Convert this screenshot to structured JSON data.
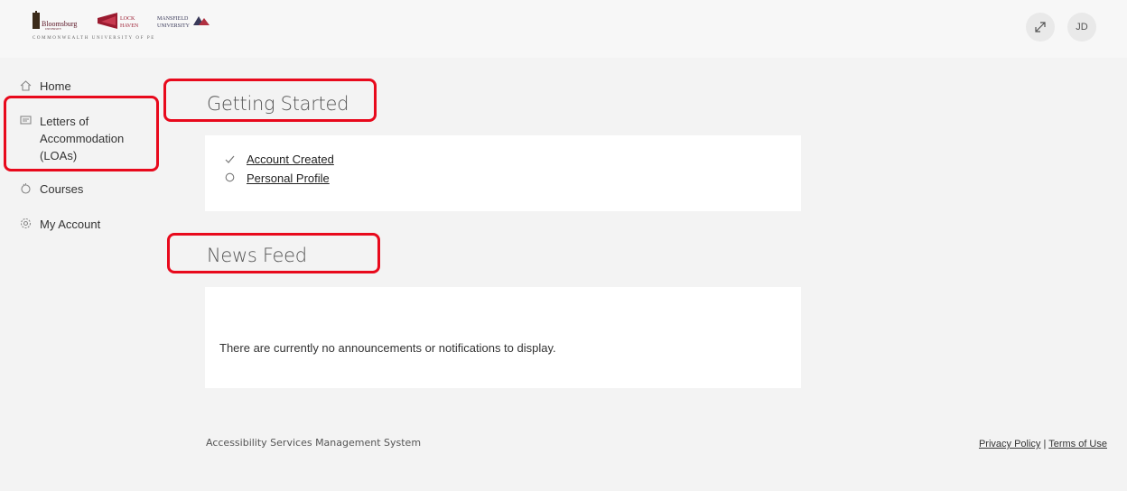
{
  "header": {
    "logo": {
      "bloomsburg": "Bloomsburg UNIVERSITY",
      "lockhaven": "LOCK HAVEN",
      "mansfield": "MANSFIELD UNIVERSITY",
      "subtitle": "COMMONWEALTH UNIVERSITY OF PE"
    },
    "expand_icon": "expand-icon",
    "avatar_initials": "JD"
  },
  "sidebar": {
    "items": [
      {
        "label": "Home",
        "icon": "home-icon"
      },
      {
        "label": "Letters of Accommodation (LOAs)",
        "icon": "message-icon"
      },
      {
        "label": "Courses",
        "icon": "courses-icon"
      },
      {
        "label": "My Account",
        "icon": "gear-icon"
      }
    ]
  },
  "getting_started": {
    "title": "Getting Started",
    "items": [
      {
        "label": "Account Created",
        "icon": "check-icon"
      },
      {
        "label": "Personal Profile",
        "icon": "circle-icon"
      }
    ]
  },
  "news_feed": {
    "title": "News Feed",
    "message": "There are currently no announcements or notifications to display."
  },
  "footer": {
    "system_name": "Accessibility Services Management System",
    "privacy": "Privacy Policy",
    "separator": "|",
    "terms": "Terms of Use"
  },
  "colors": {
    "highlight": "#e8091c",
    "background": "#f3f3f3"
  }
}
